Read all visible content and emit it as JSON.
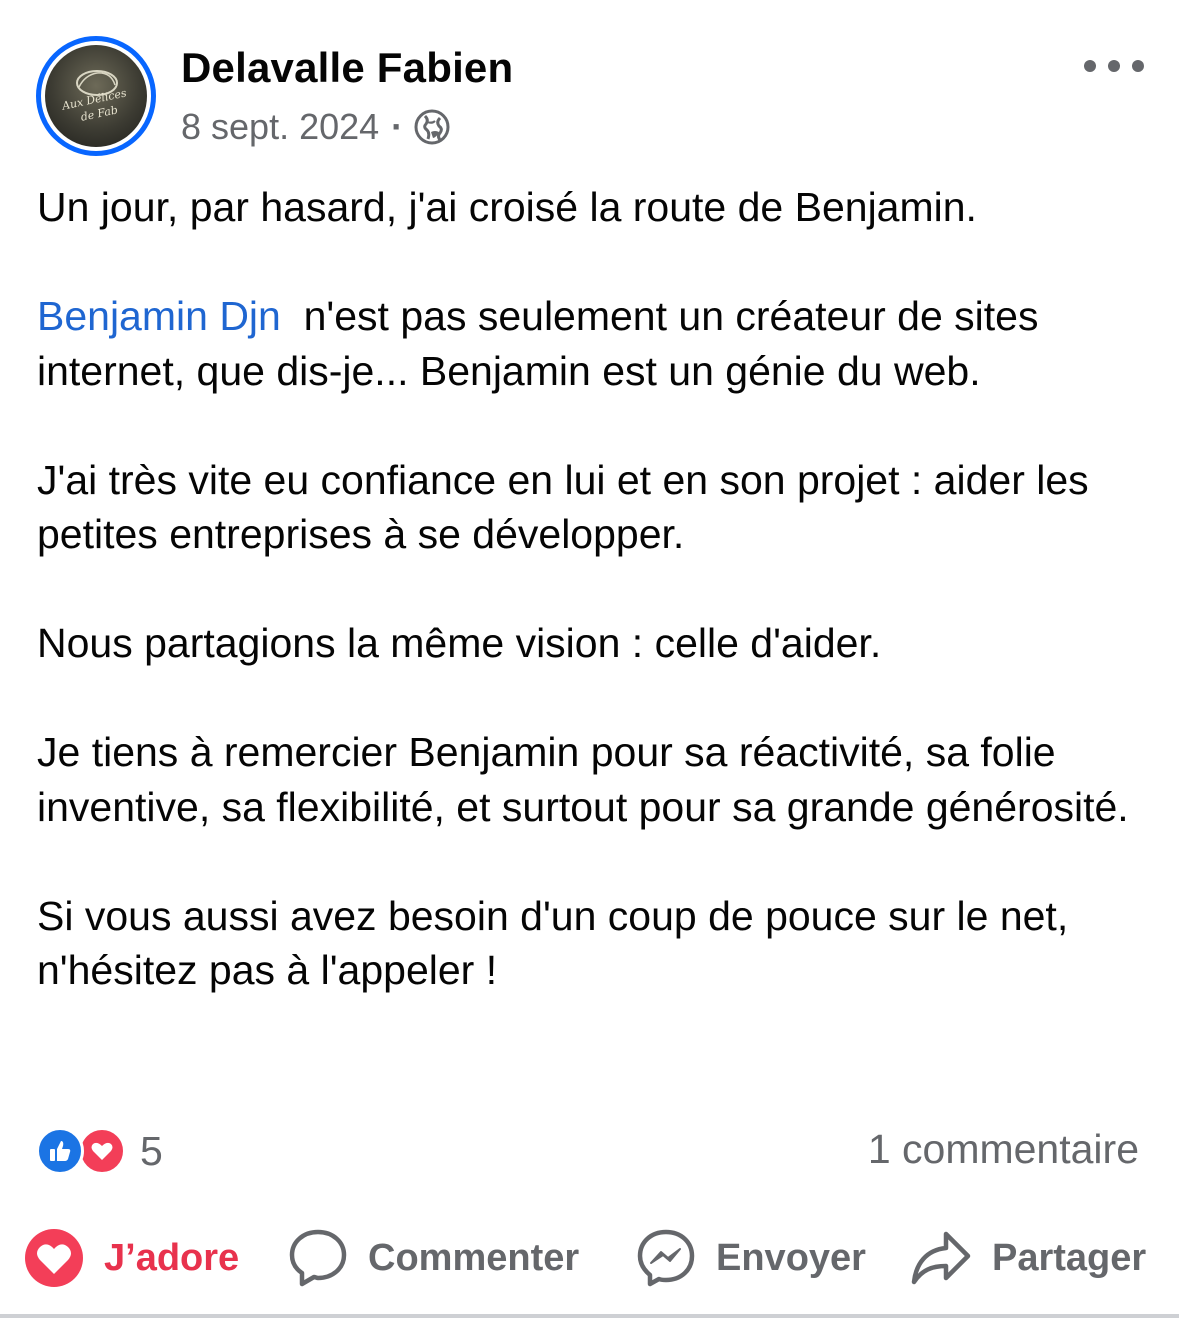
{
  "post": {
    "author": "Delavalle Fabien",
    "avatar_logo_text": "Aux Délices de Fab",
    "date": "8 sept. 2024",
    "separator": "·",
    "privacy_icon": "globe-icon",
    "more_icon": "more-horizontal-icon",
    "body": {
      "p1": "Un jour, par hasard, j'ai croisé la route de Benjamin.",
      "mention": "Benjamin Djn",
      "p2_rest": "  n'est pas seulement un créateur de sites internet, que dis-je... Benjamin est un génie du web.",
      "p3": "J'ai très vite eu confiance en lui et en son projet : aider les petites entreprises à se développer.",
      "p4": "Nous partagions la même vision : celle d'aider.",
      "p5": "Je tiens à remercier Benjamin pour sa réactivité, sa folie inventive, sa flexibilité, et surtout pour sa grande générosité.",
      "p6": "Si vous aussi avez besoin d'un coup de pouce sur le net, n'hésitez pas à l'appeler !"
    },
    "reactions": {
      "icons": [
        "like-icon",
        "love-icon"
      ],
      "count": "5"
    },
    "comments_count": "1 commentaire"
  },
  "actions": {
    "love_label": "J’adore",
    "comment_label": "Commenter",
    "send_label": "Envoyer",
    "share_label": "Partager"
  },
  "colors": {
    "accent_blue": "#0866ff",
    "mention_blue": "#1f66d1",
    "love_red": "#e8324d",
    "secondary_text": "#65676b"
  }
}
